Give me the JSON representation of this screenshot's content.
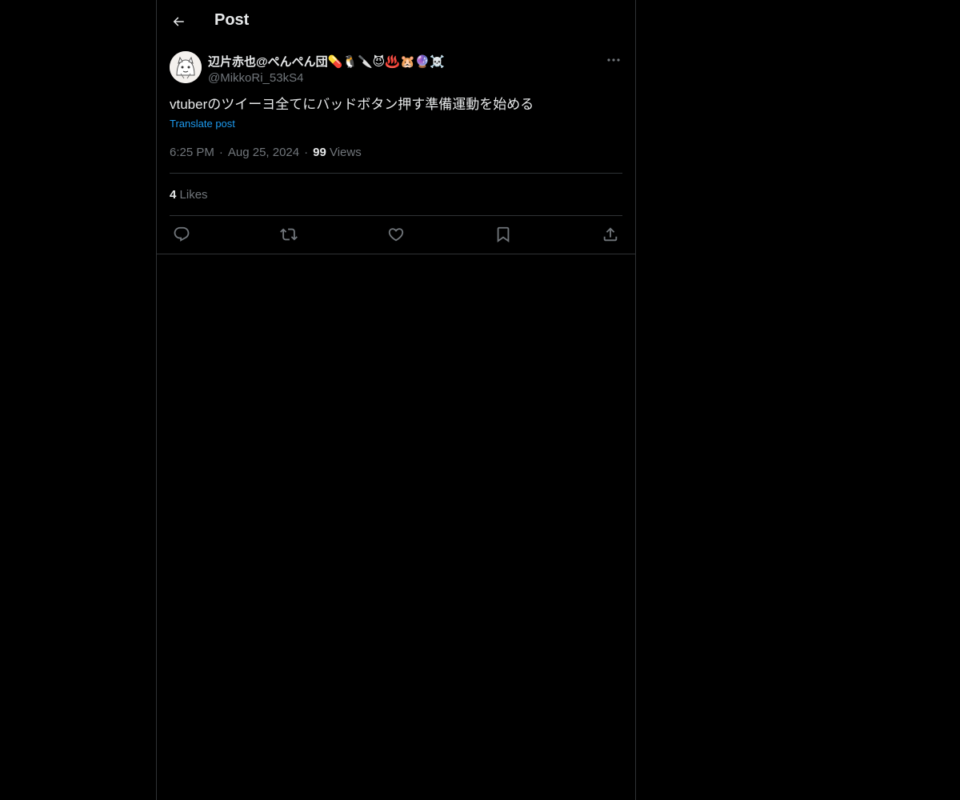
{
  "header": {
    "back_icon": "arrow-left-icon",
    "title": "Post"
  },
  "post": {
    "display_name": "辺片赤也@ぺんぺん団💊🐧🔪😈♨️🐹🔮☠️",
    "handle": "@MikkoRi_53kS4",
    "more_icon": "more-horizontal-icon",
    "text": "vtuberのツイーヨ全てにバッドボタン押す準備運動を始める",
    "translate_label": "Translate post",
    "time": "6:25 PM",
    "separator": "·",
    "date": "Aug 25, 2024",
    "views_count": "99",
    "views_label": "Views",
    "likes_count": "4",
    "likes_label": "Likes"
  },
  "actions": [
    {
      "name": "reply",
      "icon": "reply-icon"
    },
    {
      "name": "repost",
      "icon": "repost-icon"
    },
    {
      "name": "like",
      "icon": "heart-icon"
    },
    {
      "name": "bookmark",
      "icon": "bookmark-icon"
    },
    {
      "name": "share",
      "icon": "share-icon"
    }
  ],
  "colors": {
    "background": "#000000",
    "text_primary": "#e7e9ea",
    "text_secondary": "#71767b",
    "accent": "#1d9bf0",
    "border": "#2f3336"
  }
}
